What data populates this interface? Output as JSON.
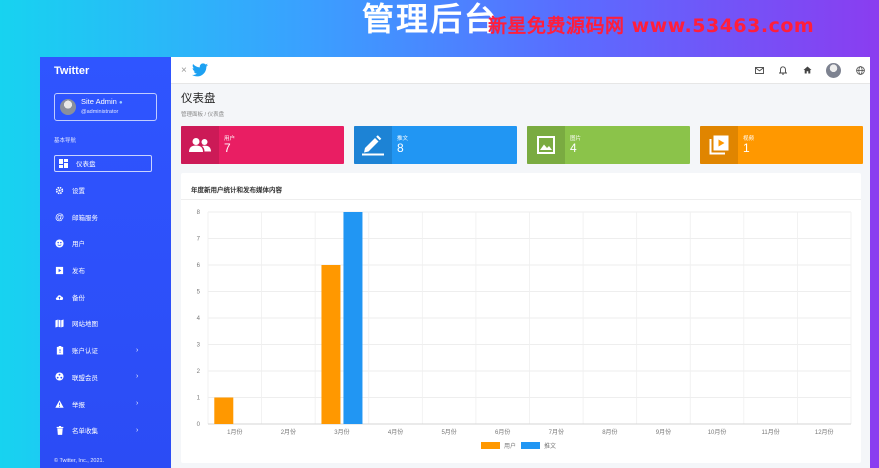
{
  "banner": {
    "title": "管理后台",
    "watermark": "新星免费源码网 www.53463.com"
  },
  "sidebar": {
    "brand": "Twitter",
    "user": {
      "name": "Site Admin",
      "handle": "@administrator"
    },
    "section": "基本导航",
    "items": [
      {
        "label": "仪表盘",
        "icon": "dashboard-icon",
        "active": true,
        "chevron": false
      },
      {
        "label": "设置",
        "icon": "gear-icon",
        "active": false,
        "chevron": false
      },
      {
        "label": "邮箱服务",
        "icon": "at-icon",
        "active": false,
        "chevron": false
      },
      {
        "label": "用户",
        "icon": "user-icon",
        "active": false,
        "chevron": false
      },
      {
        "label": "发布",
        "icon": "publish-icon",
        "active": false,
        "chevron": false
      },
      {
        "label": "备份",
        "icon": "cloud-upload-icon",
        "active": false,
        "chevron": false
      },
      {
        "label": "网站地图",
        "icon": "map-icon",
        "active": false,
        "chevron": false
      },
      {
        "label": "账户认证",
        "icon": "verify-icon",
        "active": false,
        "chevron": true
      },
      {
        "label": "联盟会员",
        "icon": "affiliate-icon",
        "active": false,
        "chevron": true
      },
      {
        "label": "举报",
        "icon": "warning-icon",
        "active": false,
        "chevron": true
      },
      {
        "label": "名单收集",
        "icon": "trash-icon",
        "active": false,
        "chevron": true
      }
    ],
    "footer": "© Twitter, Inc., 2021."
  },
  "topbar": {
    "close": "×",
    "icons": [
      "mail-icon",
      "bell-icon",
      "home-icon",
      "avatar",
      "globe-icon"
    ]
  },
  "page": {
    "title": "仪表盘",
    "breadcrumb": "管理面板 / 仪表盘"
  },
  "cards": [
    {
      "label": "用户",
      "value": "7",
      "color": "#e91e63",
      "icon": "users-icon"
    },
    {
      "label": "推文",
      "value": "8",
      "color": "#2196f3",
      "icon": "pen-icon"
    },
    {
      "label": "图片",
      "value": "4",
      "color": "#8bc34a",
      "icon": "image-icon"
    },
    {
      "label": "视频",
      "value": "1",
      "color": "#ff9800",
      "icon": "video-icon"
    }
  ],
  "chart": {
    "title": "年度新用户统计和发布媒体内容"
  },
  "chart_data": {
    "type": "bar",
    "categories": [
      "1月份",
      "2月份",
      "3月份",
      "4月份",
      "5月份",
      "6月份",
      "7月份",
      "8月份",
      "9月份",
      "10月份",
      "11月份",
      "12月份"
    ],
    "series": [
      {
        "name": "用户",
        "color": "#ff9800",
        "values": [
          1,
          0,
          6,
          0,
          0,
          0,
          0,
          0,
          0,
          0,
          0,
          0
        ]
      },
      {
        "name": "推文",
        "color": "#2196f3",
        "values": [
          0,
          0,
          8,
          0,
          0,
          0,
          0,
          0,
          0,
          0,
          0,
          0
        ]
      }
    ],
    "ylim": [
      0,
      8
    ],
    "yticks": [
      0,
      1,
      2,
      3,
      4,
      5,
      6,
      7,
      8
    ],
    "grid": true,
    "legend": "bottom-center"
  }
}
